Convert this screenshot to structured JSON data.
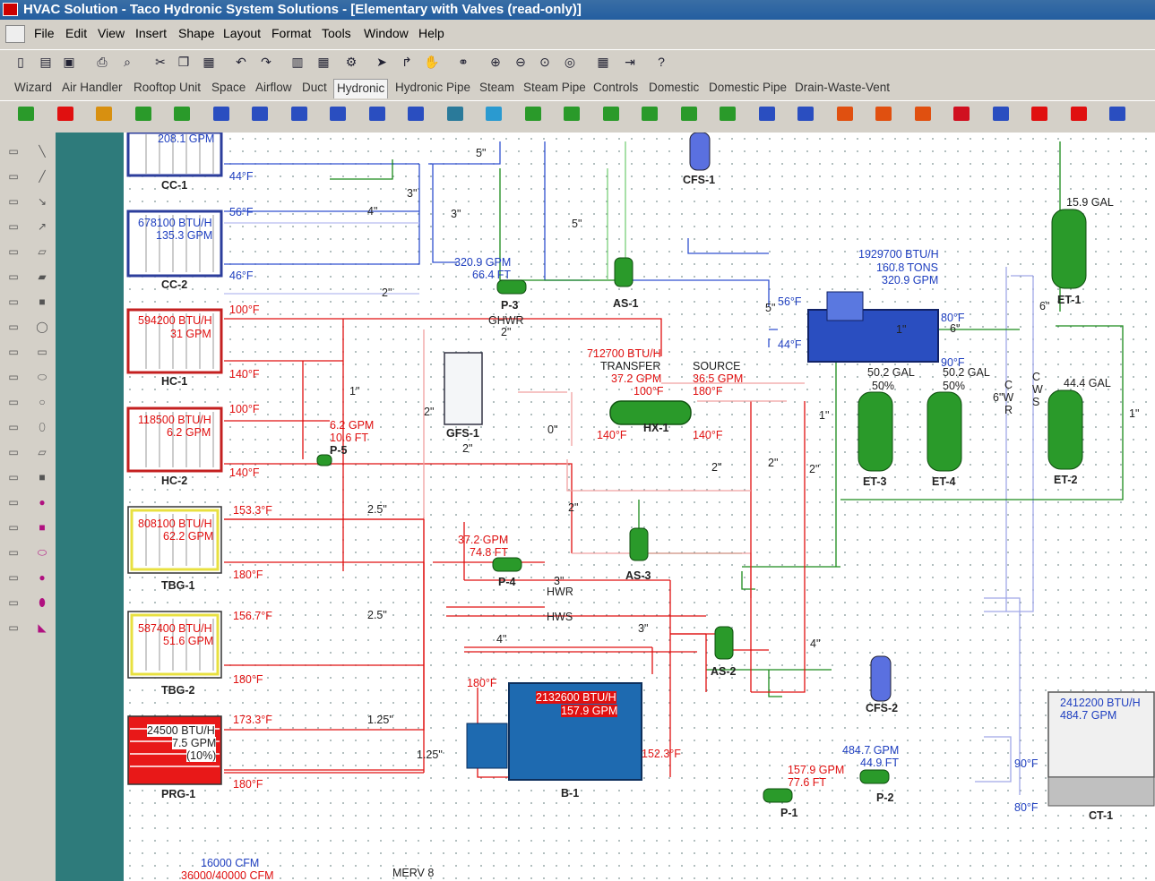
{
  "window": {
    "title": "HVAC Solution - Taco Hydronic System Solutions - [Elementary with Valves (read-only)]"
  },
  "menu": [
    "File",
    "Edit",
    "View",
    "Insert",
    "Shape",
    "Layout",
    "Format",
    "Tools",
    "Window",
    "Help"
  ],
  "toolbar_icons": [
    "new-icon",
    "open-icon",
    "save-icon",
    "print-icon",
    "print-preview-icon",
    "cut-icon",
    "copy-icon",
    "paste-icon",
    "undo-icon",
    "redo-icon",
    "properties-icon",
    "calculator-icon",
    "tool-icon",
    "pointer-icon",
    "connector-icon",
    "pan-hand-icon",
    "link-icon",
    "zoom-in-icon",
    "zoom-out-icon",
    "zoom-fit-icon",
    "zoom-page-icon",
    "snap-grid-icon",
    "align-icon",
    "help-icon"
  ],
  "tabs": [
    "Wizard",
    "Air Handler",
    "Rooftop Unit",
    "Space",
    "Airflow",
    "Duct",
    "Hydronic",
    "Hydronic Pipe",
    "Steam",
    "Steam Pipe",
    "Controls",
    "Domestic",
    "Domestic Pipe",
    "Drain-Waste-Vent"
  ],
  "active_tab": "Hydronic",
  "colors": {
    "hot": "#e01010",
    "cold": "#2040c0",
    "green": "#1a8a1a",
    "equip_green": "#2a9a2a",
    "boiler_blue": "#1e6ab0",
    "teal": "#2e7b7b",
    "title": "#245ea0"
  },
  "coils": [
    {
      "name": "CC-1",
      "line1": "208.1 GPM",
      "line2": "",
      "t_in": "",
      "t_out": "44°F",
      "type": "cooling"
    },
    {
      "name": "CC-2",
      "line1": "678100 BTU/H",
      "line2": "135.3 GPM",
      "t_in": "56°F",
      "t_out": "46°F",
      "type": "cooling"
    },
    {
      "name": "HC-1",
      "line1": "594200 BTU/H",
      "line2": "31 GPM",
      "t_in": "100°F",
      "t_out": "140°F",
      "type": "heating"
    },
    {
      "name": "HC-2",
      "line1": "118500 BTU/H",
      "line2": "6.2 GPM",
      "t_in": "100°F",
      "t_out": "140°F",
      "type": "heating"
    },
    {
      "name": "TBG-1",
      "line1": "808100 BTU/H",
      "line2": "62.2 GPM",
      "t_in": "153.3°F",
      "t_out": "180°F",
      "type": "tbg"
    },
    {
      "name": "TBG-2",
      "line1": "587400 BTU/H",
      "line2": "51.6 GPM",
      "t_in": "156.7°F",
      "t_out": "180°F",
      "type": "tbg"
    },
    {
      "name": "PRG-1",
      "line1": "24500 BTU/H",
      "line2": "7.5 GPM",
      "line3": "(10%)",
      "t_in": "173.3°F",
      "t_out": "180°F",
      "type": "prg"
    }
  ],
  "equipment": {
    "cfs1": "CFS-1",
    "cfs2": "CFS-2",
    "p3": "P-3",
    "p3_gpm": "320.9 GPM",
    "p3_ft": "66.4 FT",
    "as1": "AS-1",
    "as2": "AS-2",
    "as3": "AS-3",
    "p5": "P-5",
    "p5_gpm": "6.2 GPM",
    "p5_ft": "10.6 FT",
    "gfs1": "GFS-1",
    "hx1": "HX-1",
    "hx_btu": "712700 BTU/H",
    "hx_transfer": "TRANSFER",
    "hx_gpm": "37.2 GPM",
    "hx_t1": "100°F",
    "hx_source": "SOURCE",
    "hx_sgpm": "36.5 GPM",
    "hx_st": "180°F",
    "hx_t2": "140°F",
    "hx_t3": "140°F",
    "p4": "P-4",
    "p4_gpm": "37.2 GPM",
    "p4_ft": "74.8 FT",
    "chiller_btu": "1929700 BTU/H",
    "chiller_tons": "160.8 TONS",
    "chiller_gpm": "320.9 GPM",
    "chiller_t1": "56°F",
    "chiller_t2": "44°F",
    "chiller_t3": "80°F",
    "chiller_t4": "90°F",
    "et1": "ET-1",
    "et1_gal": "15.9 GAL",
    "et2": "ET-2",
    "et2_gal": "44.4 GAL",
    "et3": "ET-3",
    "et3_gal": "50.2 GAL",
    "et3_pct": "50%",
    "et4": "ET-4",
    "et4_gal": "50.2 GAL",
    "et4_pct": "50%",
    "b1": "B-1",
    "b1_btu": "2132600 BTU/H",
    "b1_gpm": "157.9 GPM",
    "b1_t1": "180°F",
    "b1_t2": "152.3°F",
    "p1": "P-1",
    "p1_gpm": "157.9 GPM",
    "p1_ft": "77.6 FT",
    "p2": "P-2",
    "p2_gpm": "484.7 GPM",
    "p2_ft": "44.9 FT",
    "ct1": "CT-1",
    "ct1_btu": "2412200 BTU/H",
    "ct1_gpm": "484.7 GPM",
    "ct_t1": "90°F",
    "ct_t2": "80°F"
  },
  "pipe_labels": [
    "5\"",
    "3\"",
    "4\"",
    "3\"",
    "5\"",
    "2\"",
    "GHWR",
    "2\"",
    "1\"",
    "2\"",
    "0\"",
    "2\"",
    "2\"",
    "2\"",
    "2\"",
    "1\"",
    "1\"",
    "6\"",
    "5\"",
    "2.5\"",
    "2.5\"",
    "1.25\"",
    "1.25\"",
    "2\"",
    "3\"",
    "HWR",
    "HWS",
    "4\"",
    "3\"",
    "4\"",
    "C",
    "6\"W",
    "R",
    "C",
    "W",
    "S",
    "6\"",
    "1\""
  ],
  "bottom": {
    "cfm1": "16000 CFM",
    "cfm2": "36000/40000 CFM",
    "merv": "MERV 8"
  }
}
